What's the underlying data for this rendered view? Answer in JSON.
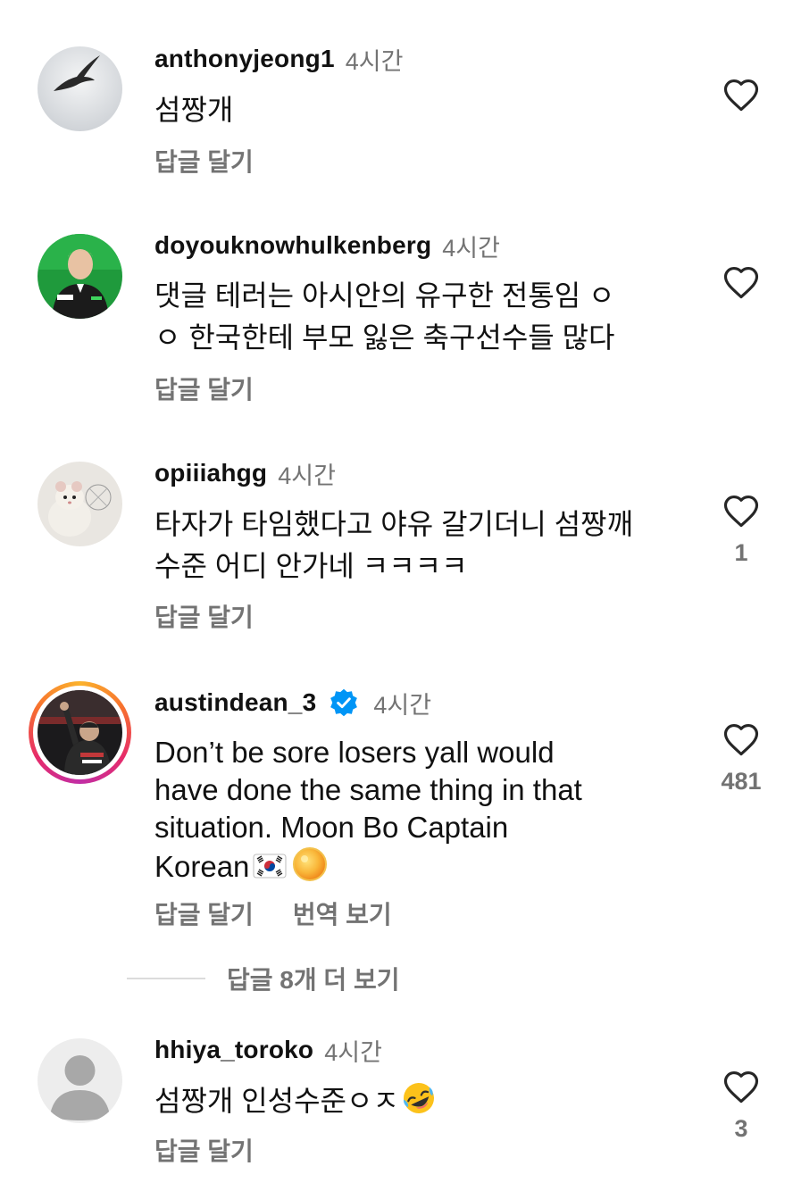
{
  "comments": [
    {
      "username": "anthonyjeong1",
      "time": "4시간",
      "text": "섬짱개",
      "reply": "답글 달기",
      "likes": ""
    },
    {
      "username": "doyouknowhulkenberg",
      "time": "4시간",
      "text_line1": "댓글 테러는 아시안의 유구한 전통임 ㅇ",
      "text_line2": "ㅇ 한국한테 부모 잃은 축구선수들 많다",
      "reply": "답글 달기",
      "likes": ""
    },
    {
      "username": "opiiiahgg",
      "time": "4시간",
      "text_line1": "타자가 타임했다고 야유 갈기더니 섬짱깨",
      "text_line2": "수준 어디 안가네 ㅋㅋㅋㅋ",
      "reply": "답글 달기",
      "likes": "1"
    },
    {
      "username": "austindean_3",
      "time": "4시간",
      "verified": true,
      "text_line1": "Don’t be sore losers yall would",
      "text_line2": "have done the same thing in that",
      "text_line3": "situation. Moon Bo Captain",
      "text_line4": "Korean",
      "reply": "답글 달기",
      "translate": "번역 보기",
      "likes": "481",
      "view_replies": "답글 8개 더 보기"
    },
    {
      "username": "hhiya_toroko",
      "time": "4시간",
      "text": "섬짱개 인성수준ㅇㅈ",
      "reply": "답글 달기",
      "likes": "3"
    }
  ],
  "colors": {
    "text_primary": "#111111",
    "text_secondary": "#737373",
    "verified_blue": "#0095f6",
    "divider": "#dbdbdb"
  },
  "icons": [
    "heart-outline-icon",
    "verified-badge-icon",
    "korea-flag-emoji",
    "sun-emoji",
    "rofl-emoji",
    "default-avatar-icon"
  ]
}
